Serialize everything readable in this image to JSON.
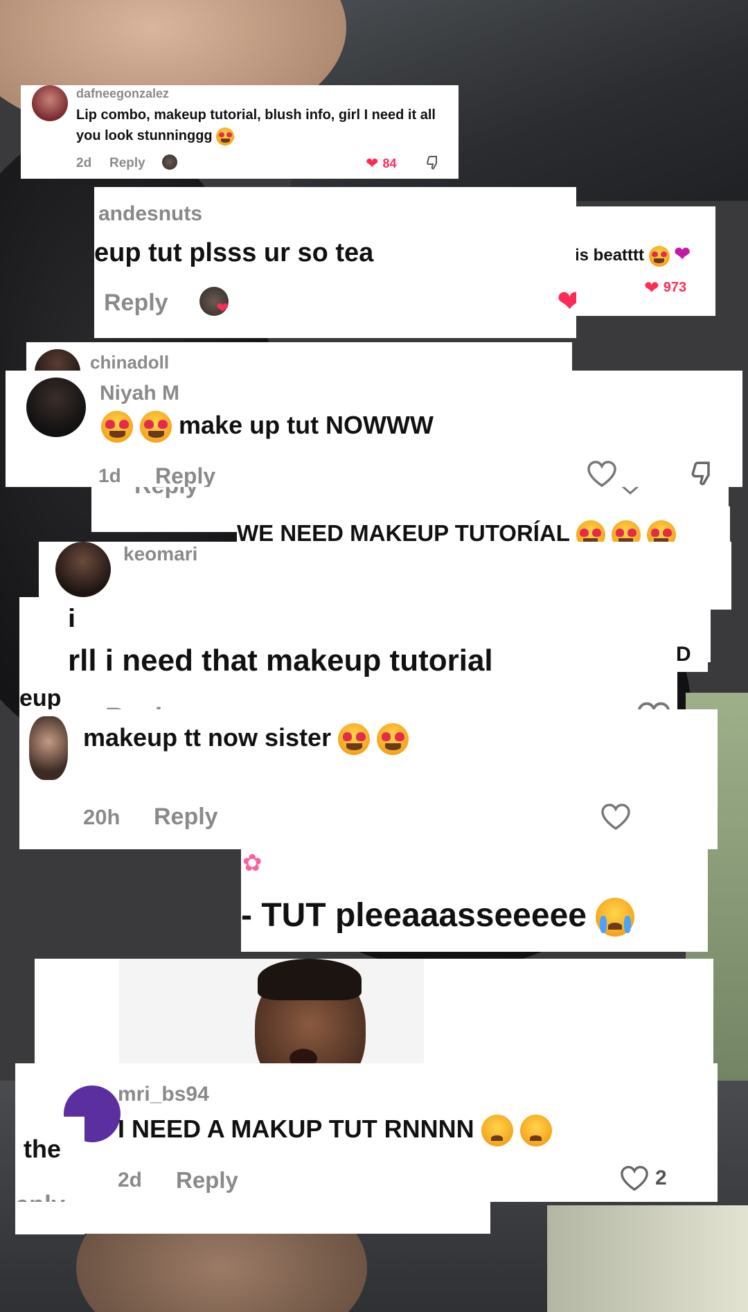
{
  "comments": {
    "c1": {
      "user": "dafneegonzalez",
      "text": "Lip combo, makeup tutorial, blush info, girl I need it all you look stunninggg",
      "time": "2d",
      "reply": "Reply",
      "likes": "84"
    },
    "c2": {
      "user": "andesnuts",
      "text": "eup tut plsss ur so tea",
      "reply": "Reply"
    },
    "c3": {
      "text": "is beatttt",
      "likes": "973"
    },
    "c4": {
      "user": "chinadoll"
    },
    "c5": {
      "user": "Niyah M",
      "text": "make up tut NOWWW",
      "time": "1d",
      "reply": "Reply"
    },
    "c6": {
      "text": "Reply"
    },
    "c7": {
      "text": "WE NEED MAKEUP TUTORÍAL"
    },
    "c8": {
      "user": "keomari"
    },
    "c9": {
      "text": "rll i need that makeup tutorial",
      "reply": "Reply",
      "side": "eup",
      "corner": "D"
    },
    "c9b": {
      "prefix": "i"
    },
    "c10": {
      "text": "makeup tt now sister",
      "time": "20h",
      "reply": "Reply"
    },
    "c11": {
      "text": "- TUT pleeaaasseeeee"
    },
    "c12": {
      "user": "mri_bs94",
      "text": "I NEED A MAKUP TUT RNNNN",
      "time": "2d",
      "reply": "Reply",
      "likes": "2",
      "side": "the",
      "reply_side": "eply"
    }
  },
  "colors": {
    "like_red": "#fe2c55",
    "muted": "#8a8a8a"
  }
}
